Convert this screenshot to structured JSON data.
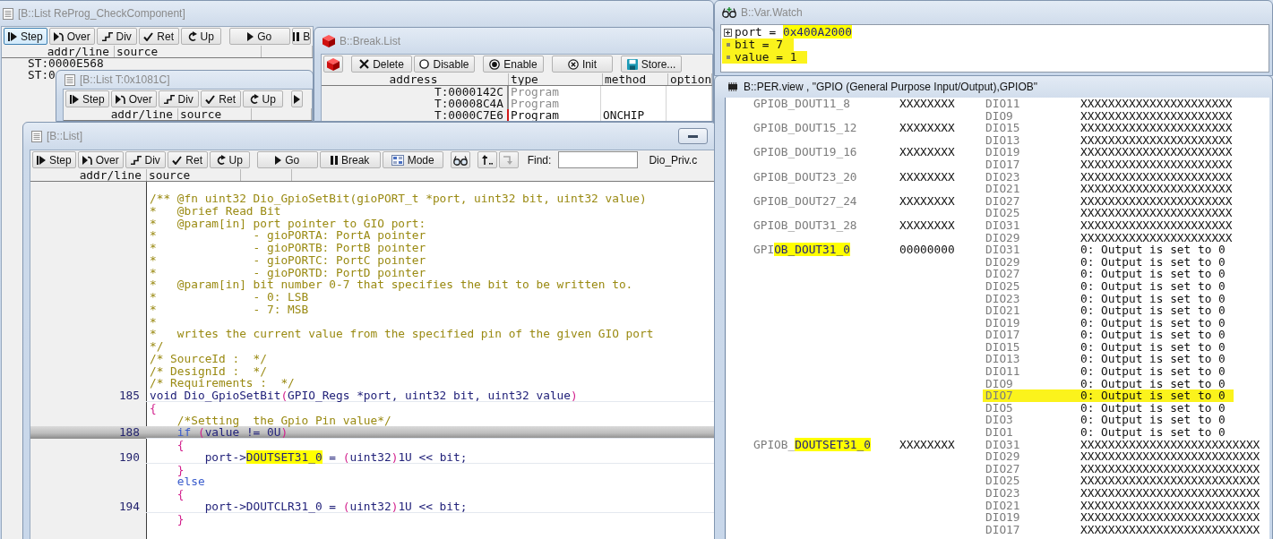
{
  "list_window_back": {
    "title": "[B::List ReProg_CheckComponent]",
    "active": false,
    "toolbar_groups": [
      {
        "buttons": [
          {
            "kind": "step",
            "label": "Step",
            "focused": true
          },
          {
            "kind": "over",
            "label": "Over",
            "focused": false
          },
          {
            "kind": "div",
            "label": "Div",
            "focused": false
          },
          {
            "kind": "ret",
            "label": "Ret",
            "focused": false
          },
          {
            "kind": "up",
            "label": "Up",
            "focused": false
          }
        ]
      },
      {
        "buttons": [
          {
            "kind": "go",
            "label": "Go",
            "focused": false
          },
          {
            "kind": "break",
            "label": "B",
            "focused": false
          }
        ]
      }
    ],
    "columns": [
      "addr/line",
      "source"
    ],
    "rows": [
      {
        "address": "ST:0000E568"
      },
      {
        "address": "ST:0"
      }
    ]
  },
  "list_window_middle": {
    "title": "[B::List T:0x1081C]",
    "active": false,
    "toolbar_groups": [
      {
        "buttons": [
          {
            "kind": "step",
            "label": "Step"
          },
          {
            "kind": "over",
            "label": "Over"
          },
          {
            "kind": "div",
            "label": "Div"
          },
          {
            "kind": "ret",
            "label": "Ret"
          },
          {
            "kind": "up",
            "label": "Up"
          }
        ]
      },
      {
        "buttons": [
          {
            "kind": "go"
          }
        ]
      }
    ],
    "columns": [
      "addr/line",
      "source"
    ]
  },
  "break_list": {
    "title": "B::Break.List",
    "active": false,
    "toolbar_groups": [
      {
        "buttons": [
          {
            "kind": "cube"
          }
        ]
      },
      {
        "buttons": [
          {
            "kind": "delete",
            "label": "Delete"
          },
          {
            "kind": "disable",
            "label": "Disable"
          }
        ]
      },
      {
        "buttons": [
          {
            "kind": "enable",
            "label": "Enable"
          }
        ]
      },
      {
        "buttons": [
          {
            "kind": "init",
            "label": "Init"
          }
        ]
      },
      {
        "buttons": [
          {
            "kind": "store",
            "label": "Store..."
          }
        ]
      }
    ],
    "columns": [
      "address",
      "type",
      "method",
      "option"
    ],
    "rows": [
      {
        "address": "T:0000142C",
        "type": "Program",
        "enabled": false
      },
      {
        "address": "T:00008C4A",
        "type": "Program",
        "enabled": false
      },
      {
        "address": "T:0000C7E6",
        "type": "Program",
        "method": "ONCHIP",
        "enabled": true
      }
    ]
  },
  "list_window": {
    "title": "[B::List]",
    "active": false,
    "toolbar_groups": [
      {
        "buttons": [
          {
            "kind": "step",
            "label": "Step",
            "disabled": false
          },
          {
            "kind": "over",
            "label": "Over",
            "disabled": false
          },
          {
            "kind": "div",
            "label": "Div",
            "disabled": false
          },
          {
            "kind": "ret",
            "label": "Ret",
            "disabled": false
          },
          {
            "kind": "up",
            "label": "Up",
            "disabled": false
          }
        ]
      },
      {
        "buttons": [
          {
            "kind": "go",
            "label": "Go",
            "disabled": false
          },
          {
            "kind": "break",
            "label": "Break",
            "disabled": false
          },
          {
            "kind": "mode",
            "label": "Mode",
            "disabled": false
          }
        ]
      },
      {
        "buttons": [
          {
            "kind": "watch",
            "disabled": false
          }
        ]
      },
      {
        "buttons": [
          {
            "kind": "track",
            "disabled": false
          },
          {
            "kind": "back",
            "disabled": true
          }
        ]
      }
    ],
    "find_label": "Find:",
    "file_name": "Dio_Priv.c",
    "columns": [
      "addr/line",
      "source"
    ],
    "lines": [
      {
        "current": false,
        "segments": [
          {
            "kind": "comment",
            "text": "/** @fn uint32 Dio_GpioSetBit(gioPORT_t *port, uint32 bit, uint32 value)"
          }
        ]
      },
      {
        "current": false,
        "segments": [
          {
            "kind": "comment",
            "text": "*   @brief Read Bit"
          }
        ]
      },
      {
        "current": false,
        "segments": [
          {
            "kind": "comment",
            "text": "*   @param[in] port pointer to GIO port:"
          }
        ]
      },
      {
        "current": false,
        "segments": [
          {
            "kind": "comment",
            "text": "*              - gioPORTA: PortA pointer"
          }
        ]
      },
      {
        "current": false,
        "segments": [
          {
            "kind": "comment",
            "text": "*              - gioPORTB: PortB pointer"
          }
        ]
      },
      {
        "current": false,
        "segments": [
          {
            "kind": "comment",
            "text": "*              - gioPORTC: PortC pointer"
          }
        ]
      },
      {
        "current": false,
        "segments": [
          {
            "kind": "comment",
            "text": "*              - gioPORTD: PortD pointer"
          }
        ]
      },
      {
        "current": false,
        "segments": [
          {
            "kind": "comment",
            "text": "*   @param[in] bit number 0-7 that specifies the bit to be written to."
          }
        ]
      },
      {
        "current": false,
        "segments": [
          {
            "kind": "comment",
            "text": "*              - 0: LSB"
          }
        ]
      },
      {
        "current": false,
        "segments": [
          {
            "kind": "comment",
            "text": "*              - 7: MSB"
          }
        ]
      },
      {
        "current": false,
        "segments": [
          {
            "kind": "comment",
            "text": "*"
          }
        ]
      },
      {
        "current": false,
        "segments": [
          {
            "kind": "comment",
            "text": "*   writes the current value from the specified pin of the given GIO port"
          }
        ]
      },
      {
        "current": false,
        "segments": [
          {
            "kind": "comment",
            "text": "*/"
          }
        ]
      },
      {
        "current": false,
        "segments": [
          {
            "kind": "comment",
            "text": "/* SourceId :  */"
          }
        ]
      },
      {
        "current": false,
        "segments": [
          {
            "kind": "comment",
            "text": "/* DesignId :  */"
          }
        ]
      },
      {
        "current": false,
        "segments": [
          {
            "kind": "comment",
            "text": "/* Requirements :  */"
          }
        ]
      },
      {
        "number": "185",
        "current": false,
        "segments": [
          {
            "kind": "text",
            "text": "void Dio_GpioSetBit"
          },
          {
            "kind": "punct",
            "text": "("
          },
          {
            "kind": "text",
            "text": "GPIO_Regs *port, uint32 bit, uint32 value"
          },
          {
            "kind": "punct",
            "text": ")"
          }
        ]
      },
      {
        "current": false,
        "segments": [
          {
            "kind": "punct",
            "text": "{"
          }
        ]
      },
      {
        "current": false,
        "segments": [
          {
            "kind": "comment",
            "text": "    /*Setting  the Gpio Pin value*/"
          }
        ]
      },
      {
        "number": "188",
        "current": true,
        "segments": [
          {
            "kind": "keyword",
            "text": "    if"
          },
          {
            "kind": "punct",
            "text": " ("
          },
          {
            "kind": "text",
            "text": "value != 0U"
          },
          {
            "kind": "punct",
            "text": ")"
          }
        ]
      },
      {
        "current": false,
        "segments": [
          {
            "kind": "punct",
            "text": "    {"
          }
        ]
      },
      {
        "number": "190",
        "current": false,
        "segments": [
          {
            "kind": "text",
            "text": "        port->"
          },
          {
            "kind": "marked",
            "text": "DOUTSET31_0"
          },
          {
            "kind": "text",
            "text": " = "
          },
          {
            "kind": "punct",
            "text": "("
          },
          {
            "kind": "text",
            "text": "uint32"
          },
          {
            "kind": "punct",
            "text": ")"
          },
          {
            "kind": "text",
            "text": "1U << bit;"
          }
        ]
      },
      {
        "current": false,
        "segments": [
          {
            "kind": "punct",
            "text": "    }"
          }
        ]
      },
      {
        "current": false,
        "segments": [
          {
            "kind": "keyword",
            "text": "    else"
          }
        ]
      },
      {
        "current": false,
        "segments": [
          {
            "kind": "punct",
            "text": "    {"
          }
        ]
      },
      {
        "number": "194",
        "current": false,
        "segments": [
          {
            "kind": "text",
            "text": "        port->DOUTCLR31_0 = "
          },
          {
            "kind": "punct",
            "text": "("
          },
          {
            "kind": "text",
            "text": "uint32"
          },
          {
            "kind": "punct",
            "text": ")"
          },
          {
            "kind": "text",
            "text": "1U << bit;"
          }
        ]
      },
      {
        "current": false,
        "segments": [
          {
            "kind": "punct",
            "text": "    }"
          }
        ]
      }
    ]
  },
  "var_watch": {
    "title": "B::Var.Watch",
    "active": false,
    "entries": [
      {
        "kind": "expandable",
        "highlighted": false,
        "parts": [
          {
            "kind": "plain",
            "text": "port = "
          },
          {
            "kind": "marked",
            "text": "0x400A2000"
          }
        ]
      },
      {
        "kind": "leaf",
        "highlighted": true,
        "parts": [
          {
            "kind": "plain",
            "text": "bit = 7"
          }
        ]
      },
      {
        "kind": "leaf",
        "highlighted": true,
        "parts": [
          {
            "kind": "plain",
            "text": "value = 1"
          }
        ]
      }
    ]
  },
  "per_view": {
    "title": "B::PER.view , \"GPIO (General Purpose Input/Output),GPIOB\"",
    "active": true,
    "registers": [
      {
        "name_parts": [
          {
            "kind": "plain",
            "text": "GPIOB_DOUT11_8"
          }
        ],
        "value": "XXXXXXXX",
        "fields": [
          {
            "name": "DIO11",
            "value": "XXXXXXXXXXXXXXXXXXXXXX",
            "highlighted": false
          },
          {
            "name": "DIO9",
            "value": "XXXXXXXXXXXXXXXXXXXXXX",
            "highlighted": false
          }
        ]
      },
      {
        "name_parts": [
          {
            "kind": "plain",
            "text": "GPIOB_DOUT15_12"
          }
        ],
        "value": "XXXXXXXX",
        "fields": [
          {
            "name": "DIO15",
            "value": "XXXXXXXXXXXXXXXXXXXXXX",
            "highlighted": false
          },
          {
            "name": "DIO13",
            "value": "XXXXXXXXXXXXXXXXXXXXXX",
            "highlighted": false
          }
        ]
      },
      {
        "name_parts": [
          {
            "kind": "plain",
            "text": "GPIOB_DOUT19_16"
          }
        ],
        "value": "XXXXXXXX",
        "fields": [
          {
            "name": "DIO19",
            "value": "XXXXXXXXXXXXXXXXXXXXXX",
            "highlighted": false
          },
          {
            "name": "DIO17",
            "value": "XXXXXXXXXXXXXXXXXXXXXX",
            "highlighted": false
          }
        ]
      },
      {
        "name_parts": [
          {
            "kind": "plain",
            "text": "GPIOB_DOUT23_20"
          }
        ],
        "value": "XXXXXXXX",
        "fields": [
          {
            "name": "DIO23",
            "value": "XXXXXXXXXXXXXXXXXXXXXX",
            "highlighted": false
          },
          {
            "name": "DIO21",
            "value": "XXXXXXXXXXXXXXXXXXXXXX",
            "highlighted": false
          }
        ]
      },
      {
        "name_parts": [
          {
            "kind": "plain",
            "text": "GPIOB_DOUT27_24"
          }
        ],
        "value": "XXXXXXXX",
        "fields": [
          {
            "name": "DIO27",
            "value": "XXXXXXXXXXXXXXXXXXXXXX",
            "highlighted": false
          },
          {
            "name": "DIO25",
            "value": "XXXXXXXXXXXXXXXXXXXXXX",
            "highlighted": false
          }
        ]
      },
      {
        "name_parts": [
          {
            "kind": "plain",
            "text": "GPIOB_DOUT31_28"
          }
        ],
        "value": "XXXXXXXX",
        "fields": [
          {
            "name": "DIO31",
            "value": "XXXXXXXXXXXXXXXXXXXXXX",
            "highlighted": false
          },
          {
            "name": "DIO29",
            "value": "XXXXXXXXXXXXXXXXXXXXXX",
            "highlighted": false
          }
        ]
      },
      {
        "name_parts": [
          {
            "kind": "plain",
            "text": "GPI"
          },
          {
            "kind": "marked",
            "text": "OB_DOUT31_0"
          }
        ],
        "value": "00000000",
        "fields": [
          {
            "name": "DIO31",
            "value": "0: Output is set to 0",
            "highlighted": false
          },
          {
            "name": "DIO29",
            "value": "0: Output is set to 0",
            "highlighted": false
          },
          {
            "name": "DIO27",
            "value": "0: Output is set to 0",
            "highlighted": false
          },
          {
            "name": "DIO25",
            "value": "0: Output is set to 0",
            "highlighted": false
          },
          {
            "name": "DIO23",
            "value": "0: Output is set to 0",
            "highlighted": false
          },
          {
            "name": "DIO21",
            "value": "0: Output is set to 0",
            "highlighted": false
          },
          {
            "name": "DIO19",
            "value": "0: Output is set to 0",
            "highlighted": false
          },
          {
            "name": "DIO17",
            "value": "0: Output is set to 0",
            "highlighted": false
          },
          {
            "name": "DIO15",
            "value": "0: Output is set to 0",
            "highlighted": false
          },
          {
            "name": "DIO13",
            "value": "0: Output is set to 0",
            "highlighted": false
          },
          {
            "name": "DIO11",
            "value": "0: Output is set to 0",
            "highlighted": false
          },
          {
            "name": "DIO9",
            "value": "0: Output is set to 0",
            "highlighted": false
          },
          {
            "name": "DIO7",
            "value": "0: Output is set to 0",
            "highlighted": true
          },
          {
            "name": "DIO5",
            "value": "0: Output is set to 0",
            "highlighted": false
          },
          {
            "name": "DIO3",
            "value": "0: Output is set to 0",
            "highlighted": false
          },
          {
            "name": "DIO1",
            "value": "0: Output is set to 0",
            "highlighted": false
          }
        ]
      },
      {
        "name_parts": [
          {
            "kind": "plain",
            "text": "GPIOB_"
          },
          {
            "kind": "marked",
            "text": "DOUTSET31_0"
          }
        ],
        "value": "XXXXXXXX",
        "fields": [
          {
            "name": "DIO31",
            "value": "XXXXXXXXXXXXXXXXXXXXXXXXXX",
            "highlighted": false
          },
          {
            "name": "DIO29",
            "value": "XXXXXXXXXXXXXXXXXXXXXXXXXX",
            "highlighted": false
          },
          {
            "name": "DIO27",
            "value": "XXXXXXXXXXXXXXXXXXXXXXXXXX",
            "highlighted": false
          },
          {
            "name": "DIO25",
            "value": "XXXXXXXXXXXXXXXXXXXXXXXXXX",
            "highlighted": false
          },
          {
            "name": "DIO23",
            "value": "XXXXXXXXXXXXXXXXXXXXXXXXXX",
            "highlighted": false
          },
          {
            "name": "DIO21",
            "value": "XXXXXXXXXXXXXXXXXXXXXXXXXX",
            "highlighted": false
          },
          {
            "name": "DIO19",
            "value": "XXXXXXXXXXXXXXXXXXXXXXXXXX",
            "highlighted": false
          },
          {
            "name": "DIO17",
            "value": "XXXXXXXXXXXXXXXXXXXXXXXXXX",
            "highlighted": false
          }
        ]
      }
    ]
  }
}
